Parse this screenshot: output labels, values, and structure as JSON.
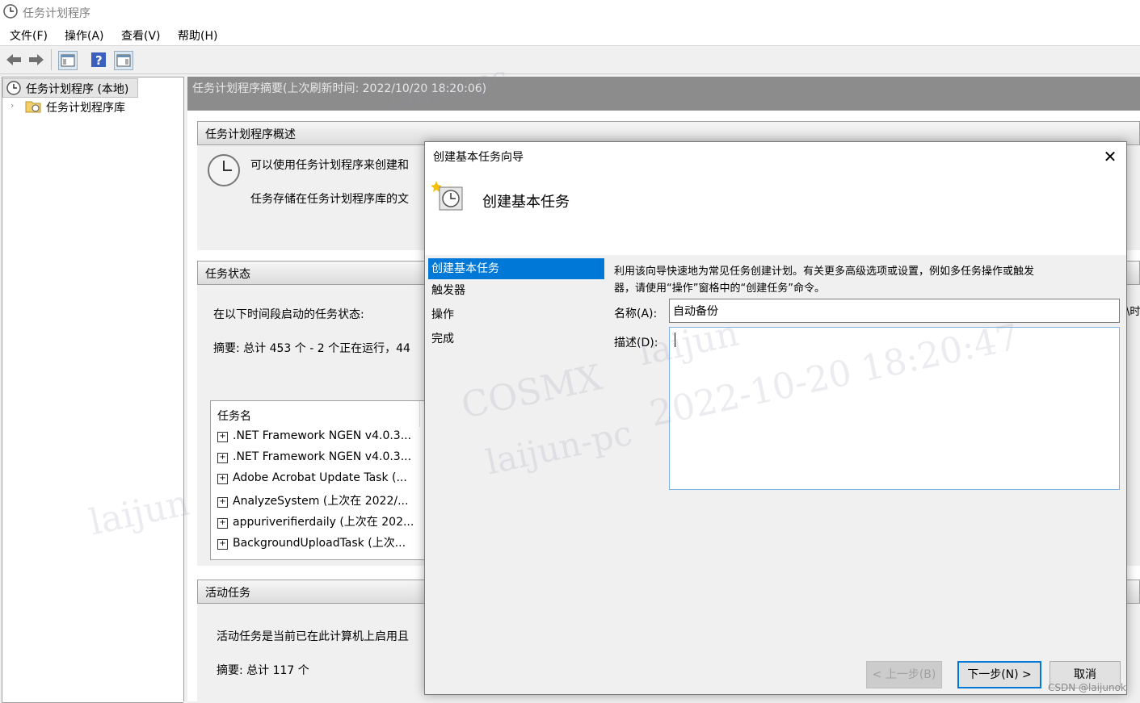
{
  "window": {
    "title": "任务计划程序"
  },
  "menu": [
    "文件(F)",
    "操作(A)",
    "查看(V)",
    "帮助(H)"
  ],
  "tree": {
    "root": "任务计划程序 (本地)",
    "child": "任务计划程序库"
  },
  "summary": {
    "header": "任务计划程序摘要(上次刷新时间: 2022/10/20 18:20:06)",
    "overview_title": "任务计划程序概述",
    "overview_line1": "可以使用任务计划程序来创建和",
    "overview_line2": "任务存储在任务计划程序库的文",
    "status_title": "任务状态",
    "status_label": "在以下时间段启动的任务状态:",
    "status_summary": "摘要: 总计 453 个 - 2 个正在运行，44",
    "task_column": "任务名",
    "tasks": [
      ".NET Framework NGEN v4.0.3...",
      ".NET Framework NGEN v4.0.3...",
      "Adobe Acrobat Update Task (...",
      "AnalyzeSystem (上次在 2022/...",
      "appuriverifierdaily (上次在 202...",
      "BackgroundUploadTask (上次..."
    ],
    "active_title": "活动任务",
    "active_desc": "活动任务是当前已在此计算机上启用且",
    "active_summary": "摘要: 总计 117 个"
  },
  "dialog": {
    "title": "创建基本任务向导",
    "heading": "创建基本任务",
    "steps": [
      "创建基本任务",
      "触发器",
      "操作",
      "完成"
    ],
    "intro_line1": "利用该向导快速地为常见任务创建计划。有关更多高级选项或设置，例如多任务操作或触发",
    "intro_line2": "器，请使用“操作”窗格中的“创建任务”命令。",
    "name_label": "名称(A):",
    "name_value": "自动备份",
    "desc_label": "描述(D):",
    "desc_value": "",
    "back_button": "< 上一步(B)",
    "next_button": "下一步(N) >",
    "cancel_button": "取消"
  },
  "side_text": "\\时",
  "footer_credit": "CSDN @laijunok",
  "watermark_lines": [
    "laijun-pc",
    "COSMX",
    "laijun",
    "2022-10-20 18:20:47"
  ]
}
